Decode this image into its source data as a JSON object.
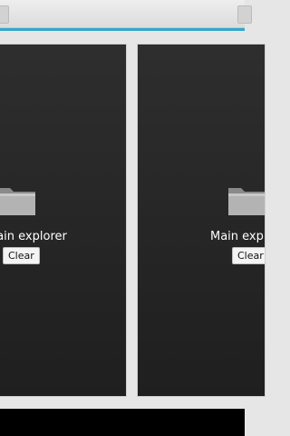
{
  "colors": {
    "accent": "#33a7c9"
  },
  "panels": [
    {
      "icon": "folder-icon",
      "title": "Main explorer",
      "clear_label": "Clear"
    },
    {
      "icon": "folder-icon",
      "title": "Main explorer",
      "clear_label": "Clear"
    }
  ]
}
